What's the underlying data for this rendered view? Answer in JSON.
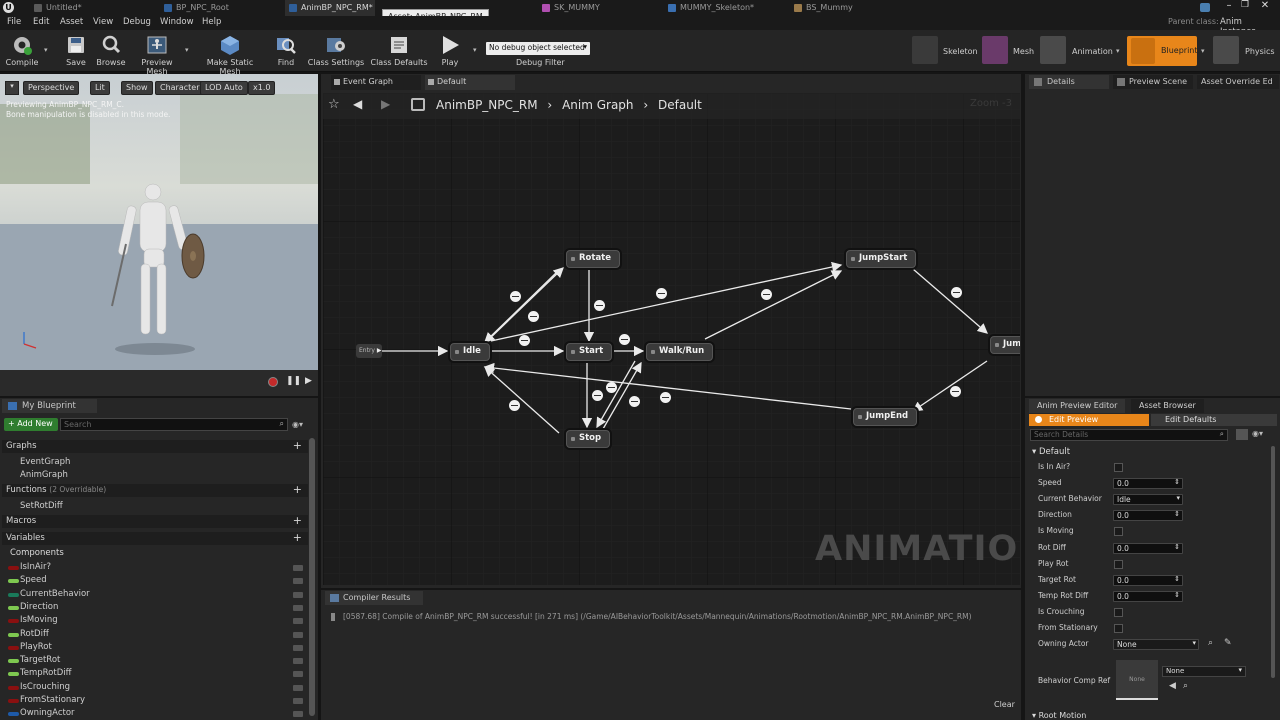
{
  "window": {
    "tabs": [
      {
        "label": "Untitled*",
        "color": "#5a5a5a"
      },
      {
        "label": "BP_NPC_Root",
        "color": "#2f5f9a"
      },
      {
        "label": "AnimBP_NPC_RM*",
        "color": "#2f5f9a"
      },
      {
        "label": "SK_MUMMY",
        "color": "#b04fb0"
      },
      {
        "label": "MUMMY_Skeleton*",
        "color": "#3a6fb0"
      },
      {
        "label": "BS_Mummy",
        "color": "#9a7a4a"
      }
    ],
    "tooltip": "Asset: AnimBP_NPC_RM",
    "parent_class_label": "Parent class:",
    "parent_class_value": "Anim Instance"
  },
  "menu": [
    "File",
    "Edit",
    "Asset",
    "View",
    "Debug",
    "Window",
    "Help"
  ],
  "toolbar": {
    "buttons": [
      "Compile",
      "Save",
      "Browse",
      "Preview Mesh",
      "Make Static Mesh",
      "Find",
      "Class Settings",
      "Class Defaults",
      "Play"
    ],
    "debug_select": "No debug object selected",
    "debug_filter": "Debug Filter",
    "modes": [
      "Skeleton",
      "Mesh",
      "Animation",
      "Blueprint",
      "Physics"
    ]
  },
  "viewport": {
    "buttons": [
      "Perspective",
      "Lit",
      "Show",
      "Character",
      "LOD Auto",
      "x1.0"
    ],
    "info_line1": "Previewing AnimBP_NPC_RM_C.",
    "info_line2": "Bone manipulation is disabled in this mode."
  },
  "my_blueprint": {
    "title": "My Blueprint",
    "add_new": "+ Add New",
    "search_placeholder": "Search",
    "graphs_label": "Graphs",
    "graphs": [
      "EventGraph",
      "AnimGraph"
    ],
    "functions_label": "Functions",
    "functions_note": "(2 Overridable)",
    "functions": [
      "SetRotDiff"
    ],
    "macros_label": "Macros",
    "variables_label": "Variables",
    "components_label": "Components",
    "variables": [
      {
        "name": "IsInAir?",
        "color": "#8a1010"
      },
      {
        "name": "Speed",
        "color": "#7ec850"
      },
      {
        "name": "CurrentBehavior",
        "color": "#1a7a5a"
      },
      {
        "name": "Direction",
        "color": "#7ec850"
      },
      {
        "name": "IsMoving",
        "color": "#8a1010"
      },
      {
        "name": "RotDiff",
        "color": "#7ec850"
      },
      {
        "name": "PlayRot",
        "color": "#8a1010"
      },
      {
        "name": "TargetRot",
        "color": "#7ec850"
      },
      {
        "name": "TempRotDiff",
        "color": "#7ec850"
      },
      {
        "name": "IsCrouching",
        "color": "#8a1010"
      },
      {
        "name": "FromStationary",
        "color": "#8a1010"
      },
      {
        "name": "OwningActor",
        "color": "#1e5aa8"
      }
    ]
  },
  "graph": {
    "tabs": [
      "Event Graph",
      "Default"
    ],
    "breadcrumb": [
      "AnimBP_NPC_RM",
      "Anim Graph",
      "Default"
    ],
    "zoom": "Zoom -3",
    "watermark": "ANIMATION",
    "entry": "Entry",
    "states": [
      "Rotate",
      "JumpStart",
      "Idle",
      "Start",
      "Walk/Run",
      "Jum",
      "JumpEnd",
      "Stop"
    ]
  },
  "compiler": {
    "tab": "Compiler Results",
    "message": "[0587.68] Compile of AnimBP_NPC_RM successful! [in 271 ms] (/Game/AIBehaviorToolkit/Assets/Mannequin/Animations/Rootmotion/AnimBP_NPC_RM.AnimBP_NPC_RM)",
    "clear": "Clear"
  },
  "details": {
    "tabs": [
      "Details",
      "Preview Scene",
      "Asset Override Ed"
    ]
  },
  "anim_preview": {
    "tabs": [
      "Anim Preview Editor",
      "Asset Browser"
    ],
    "edit_preview": "Edit Preview",
    "edit_defaults": "Edit Defaults",
    "search_placeholder": "Search Details",
    "category": "Default",
    "props": [
      {
        "label": "Is In Air?",
        "type": "check"
      },
      {
        "label": "Speed",
        "type": "num",
        "value": "0.0"
      },
      {
        "label": "Current Behavior",
        "type": "select",
        "value": "Idle"
      },
      {
        "label": "Direction",
        "type": "num",
        "value": "0.0"
      },
      {
        "label": "Is Moving",
        "type": "check"
      },
      {
        "label": "Rot Diff",
        "type": "num",
        "value": "0.0"
      },
      {
        "label": "Play Rot",
        "type": "check"
      },
      {
        "label": "Target Rot",
        "type": "num",
        "value": "0.0"
      },
      {
        "label": "Temp Rot Diff",
        "type": "num",
        "value": "0.0"
      },
      {
        "label": "Is Crouching",
        "type": "check"
      },
      {
        "label": "From Stationary",
        "type": "check"
      },
      {
        "label": "Owning Actor",
        "type": "select",
        "value": "None"
      }
    ],
    "behavior_comp_label": "Behavior Comp Ref",
    "behavior_comp_thumb": "None",
    "behavior_comp_value": "None",
    "root_motion": "Root Motion"
  },
  "colors": {
    "accent_orange": "#e8861a",
    "compile_green": "#3aa13a",
    "link_white": "#eaeaea"
  }
}
